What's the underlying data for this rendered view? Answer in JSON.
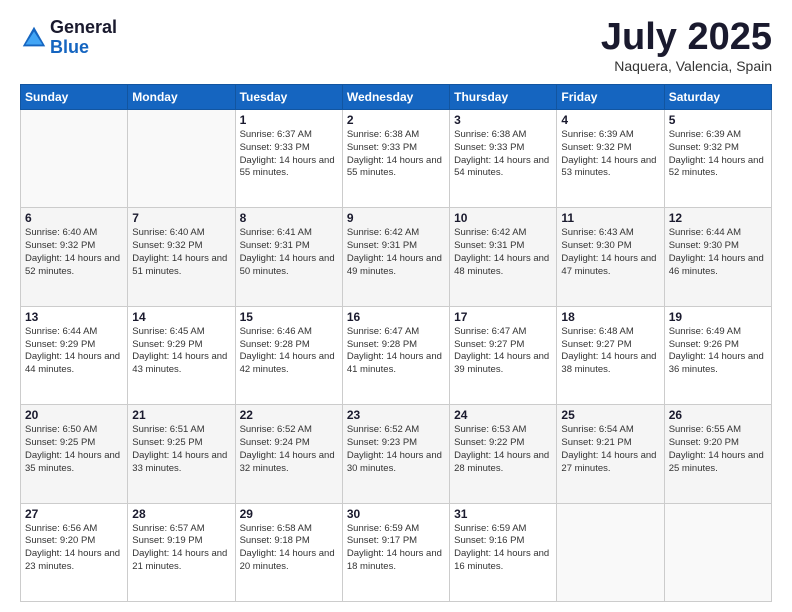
{
  "logo": {
    "general": "General",
    "blue": "Blue"
  },
  "title": "July 2025",
  "location": "Naquera, Valencia, Spain",
  "days_of_week": [
    "Sunday",
    "Monday",
    "Tuesday",
    "Wednesday",
    "Thursday",
    "Friday",
    "Saturday"
  ],
  "weeks": [
    [
      {
        "day": "",
        "sunrise": "",
        "sunset": "",
        "daylight": ""
      },
      {
        "day": "",
        "sunrise": "",
        "sunset": "",
        "daylight": ""
      },
      {
        "day": "1",
        "sunrise": "Sunrise: 6:37 AM",
        "sunset": "Sunset: 9:33 PM",
        "daylight": "Daylight: 14 hours and 55 minutes."
      },
      {
        "day": "2",
        "sunrise": "Sunrise: 6:38 AM",
        "sunset": "Sunset: 9:33 PM",
        "daylight": "Daylight: 14 hours and 55 minutes."
      },
      {
        "day": "3",
        "sunrise": "Sunrise: 6:38 AM",
        "sunset": "Sunset: 9:33 PM",
        "daylight": "Daylight: 14 hours and 54 minutes."
      },
      {
        "day": "4",
        "sunrise": "Sunrise: 6:39 AM",
        "sunset": "Sunset: 9:32 PM",
        "daylight": "Daylight: 14 hours and 53 minutes."
      },
      {
        "day": "5",
        "sunrise": "Sunrise: 6:39 AM",
        "sunset": "Sunset: 9:32 PM",
        "daylight": "Daylight: 14 hours and 52 minutes."
      }
    ],
    [
      {
        "day": "6",
        "sunrise": "Sunrise: 6:40 AM",
        "sunset": "Sunset: 9:32 PM",
        "daylight": "Daylight: 14 hours and 52 minutes."
      },
      {
        "day": "7",
        "sunrise": "Sunrise: 6:40 AM",
        "sunset": "Sunset: 9:32 PM",
        "daylight": "Daylight: 14 hours and 51 minutes."
      },
      {
        "day": "8",
        "sunrise": "Sunrise: 6:41 AM",
        "sunset": "Sunset: 9:31 PM",
        "daylight": "Daylight: 14 hours and 50 minutes."
      },
      {
        "day": "9",
        "sunrise": "Sunrise: 6:42 AM",
        "sunset": "Sunset: 9:31 PM",
        "daylight": "Daylight: 14 hours and 49 minutes."
      },
      {
        "day": "10",
        "sunrise": "Sunrise: 6:42 AM",
        "sunset": "Sunset: 9:31 PM",
        "daylight": "Daylight: 14 hours and 48 minutes."
      },
      {
        "day": "11",
        "sunrise": "Sunrise: 6:43 AM",
        "sunset": "Sunset: 9:30 PM",
        "daylight": "Daylight: 14 hours and 47 minutes."
      },
      {
        "day": "12",
        "sunrise": "Sunrise: 6:44 AM",
        "sunset": "Sunset: 9:30 PM",
        "daylight": "Daylight: 14 hours and 46 minutes."
      }
    ],
    [
      {
        "day": "13",
        "sunrise": "Sunrise: 6:44 AM",
        "sunset": "Sunset: 9:29 PM",
        "daylight": "Daylight: 14 hours and 44 minutes."
      },
      {
        "day": "14",
        "sunrise": "Sunrise: 6:45 AM",
        "sunset": "Sunset: 9:29 PM",
        "daylight": "Daylight: 14 hours and 43 minutes."
      },
      {
        "day": "15",
        "sunrise": "Sunrise: 6:46 AM",
        "sunset": "Sunset: 9:28 PM",
        "daylight": "Daylight: 14 hours and 42 minutes."
      },
      {
        "day": "16",
        "sunrise": "Sunrise: 6:47 AM",
        "sunset": "Sunset: 9:28 PM",
        "daylight": "Daylight: 14 hours and 41 minutes."
      },
      {
        "day": "17",
        "sunrise": "Sunrise: 6:47 AM",
        "sunset": "Sunset: 9:27 PM",
        "daylight": "Daylight: 14 hours and 39 minutes."
      },
      {
        "day": "18",
        "sunrise": "Sunrise: 6:48 AM",
        "sunset": "Sunset: 9:27 PM",
        "daylight": "Daylight: 14 hours and 38 minutes."
      },
      {
        "day": "19",
        "sunrise": "Sunrise: 6:49 AM",
        "sunset": "Sunset: 9:26 PM",
        "daylight": "Daylight: 14 hours and 36 minutes."
      }
    ],
    [
      {
        "day": "20",
        "sunrise": "Sunrise: 6:50 AM",
        "sunset": "Sunset: 9:25 PM",
        "daylight": "Daylight: 14 hours and 35 minutes."
      },
      {
        "day": "21",
        "sunrise": "Sunrise: 6:51 AM",
        "sunset": "Sunset: 9:25 PM",
        "daylight": "Daylight: 14 hours and 33 minutes."
      },
      {
        "day": "22",
        "sunrise": "Sunrise: 6:52 AM",
        "sunset": "Sunset: 9:24 PM",
        "daylight": "Daylight: 14 hours and 32 minutes."
      },
      {
        "day": "23",
        "sunrise": "Sunrise: 6:52 AM",
        "sunset": "Sunset: 9:23 PM",
        "daylight": "Daylight: 14 hours and 30 minutes."
      },
      {
        "day": "24",
        "sunrise": "Sunrise: 6:53 AM",
        "sunset": "Sunset: 9:22 PM",
        "daylight": "Daylight: 14 hours and 28 minutes."
      },
      {
        "day": "25",
        "sunrise": "Sunrise: 6:54 AM",
        "sunset": "Sunset: 9:21 PM",
        "daylight": "Daylight: 14 hours and 27 minutes."
      },
      {
        "day": "26",
        "sunrise": "Sunrise: 6:55 AM",
        "sunset": "Sunset: 9:20 PM",
        "daylight": "Daylight: 14 hours and 25 minutes."
      }
    ],
    [
      {
        "day": "27",
        "sunrise": "Sunrise: 6:56 AM",
        "sunset": "Sunset: 9:20 PM",
        "daylight": "Daylight: 14 hours and 23 minutes."
      },
      {
        "day": "28",
        "sunrise": "Sunrise: 6:57 AM",
        "sunset": "Sunset: 9:19 PM",
        "daylight": "Daylight: 14 hours and 21 minutes."
      },
      {
        "day": "29",
        "sunrise": "Sunrise: 6:58 AM",
        "sunset": "Sunset: 9:18 PM",
        "daylight": "Daylight: 14 hours and 20 minutes."
      },
      {
        "day": "30",
        "sunrise": "Sunrise: 6:59 AM",
        "sunset": "Sunset: 9:17 PM",
        "daylight": "Daylight: 14 hours and 18 minutes."
      },
      {
        "day": "31",
        "sunrise": "Sunrise: 6:59 AM",
        "sunset": "Sunset: 9:16 PM",
        "daylight": "Daylight: 14 hours and 16 minutes."
      },
      {
        "day": "",
        "sunrise": "",
        "sunset": "",
        "daylight": ""
      },
      {
        "day": "",
        "sunrise": "",
        "sunset": "",
        "daylight": ""
      }
    ]
  ]
}
